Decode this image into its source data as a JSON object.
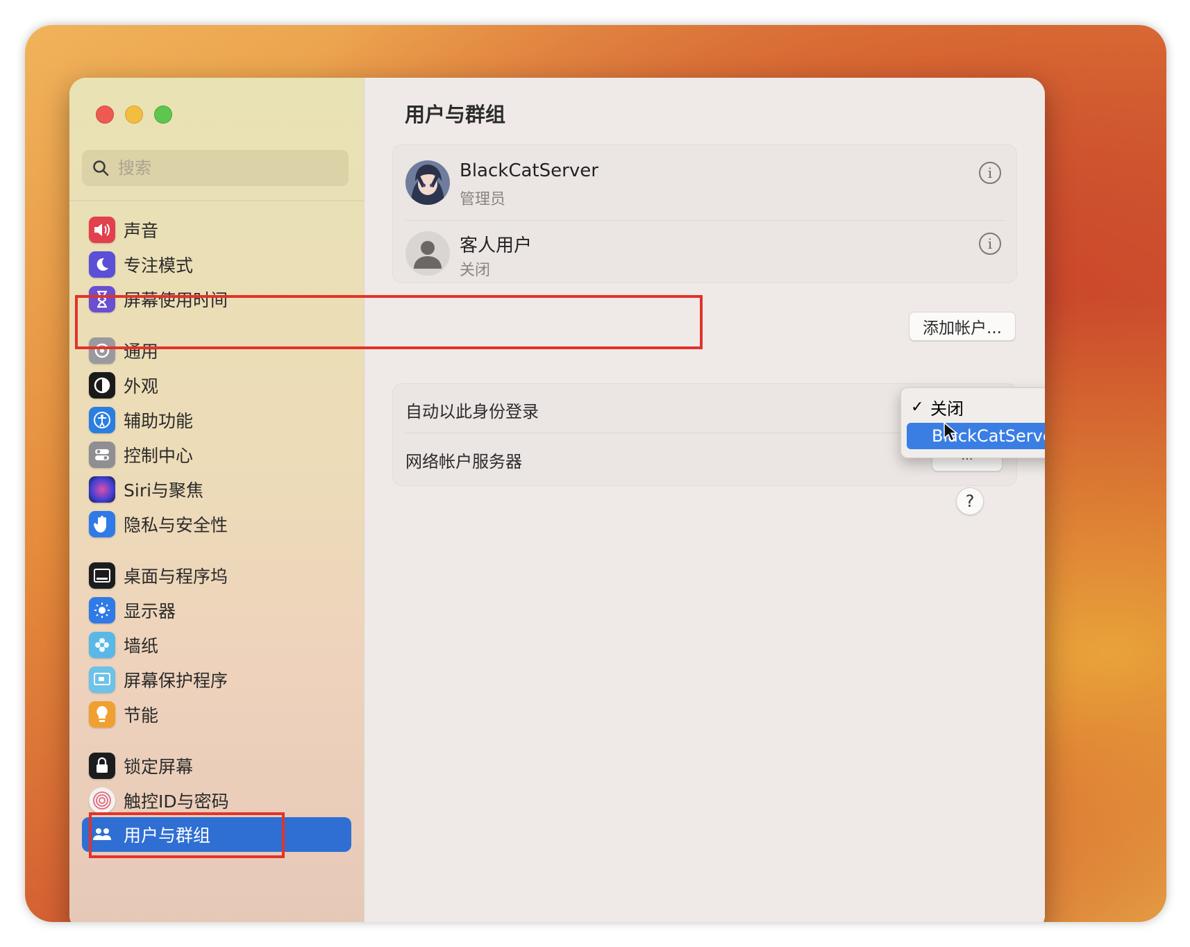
{
  "window": {
    "title": "用户与群组"
  },
  "search": {
    "placeholder": "搜索"
  },
  "sidebar": {
    "items": [
      {
        "label": "声音",
        "icon": "speaker-icon",
        "color": "#e2404c"
      },
      {
        "label": "专注模式",
        "icon": "moon-icon",
        "color": "#5a4fd6"
      },
      {
        "label": "屏幕使用时间",
        "icon": "hourglass-icon",
        "color": "#6a4fd0"
      },
      {
        "label": "通用",
        "icon": "gear-icon",
        "color": "#9a9a9e"
      },
      {
        "label": "外观",
        "icon": "appearance-icon",
        "color": "#1a1a1a"
      },
      {
        "label": "辅助功能",
        "icon": "accessibility-icon",
        "color": "#2a7ee0"
      },
      {
        "label": "控制中心",
        "icon": "control-center-icon",
        "color": "#8e8e93"
      },
      {
        "label": "Siri与聚焦",
        "icon": "siri-icon",
        "color": "#222244"
      },
      {
        "label": "隐私与安全性",
        "icon": "hand-icon",
        "color": "#2f7ae6"
      },
      {
        "label": "桌面与程序坞",
        "icon": "dock-icon",
        "color": "#1c1c1e"
      },
      {
        "label": "显示器",
        "icon": "display-brightness-icon",
        "color": "#2f7ae6"
      },
      {
        "label": "墙纸",
        "icon": "wallpaper-flower-icon",
        "color": "#5ab8e6"
      },
      {
        "label": "屏幕保护程序",
        "icon": "screensaver-icon",
        "color": "#6cc2e8"
      },
      {
        "label": "节能",
        "icon": "lightbulb-icon",
        "color": "#f0a030"
      },
      {
        "label": "锁定屏幕",
        "icon": "lock-icon",
        "color": "#1c1c1e"
      },
      {
        "label": "触控ID与密码",
        "icon": "fingerprint-icon",
        "color": "#e5677a"
      },
      {
        "label": "用户与群组",
        "icon": "users-icon",
        "color": "#2f6fd3",
        "active": true
      }
    ]
  },
  "main": {
    "title": "用户与群组",
    "users": [
      {
        "name": "BlackCatServer",
        "role": "管理员",
        "avatar": "anime-avatar"
      },
      {
        "name": "客人用户",
        "role": "关闭",
        "avatar": "person-silhouette-icon"
      }
    ],
    "add_account_label": "添加帐户...",
    "auto_login_label": "自动以此身份登录",
    "network_server_label": "网络帐户服务器",
    "help_label": "?"
  },
  "popup": {
    "options": [
      {
        "label": "关闭",
        "checked": true,
        "check_mark": "✓"
      },
      {
        "label": "BlackCatServer",
        "highlighted": true
      }
    ]
  }
}
